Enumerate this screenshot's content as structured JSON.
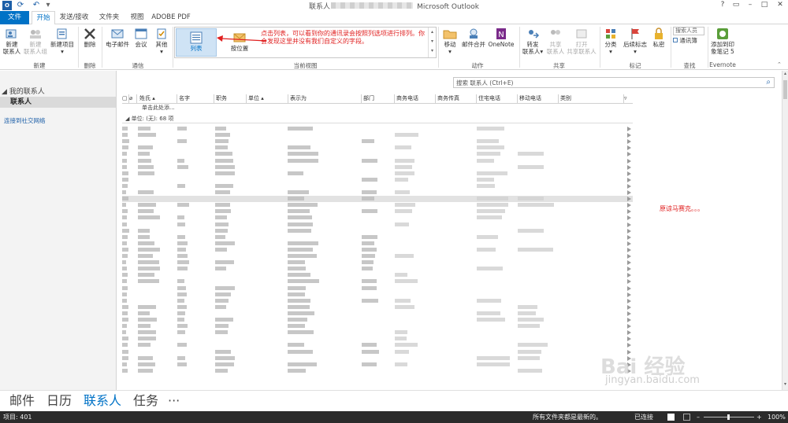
{
  "title_bar": {
    "title_left": "联系人",
    "title_right": "Microsoft Outlook",
    "quick_access": [
      "outlook-logo-icon",
      "send-receive-icon",
      "undo-icon",
      "customize-qat-icon"
    ],
    "window_controls": [
      "?",
      "restore",
      "–",
      "□",
      "✕"
    ]
  },
  "ribbon_tabs": [
    "文件",
    "开始",
    "发送/接收",
    "文件夹",
    "视图",
    "ADOBE PDF"
  ],
  "ribbon": {
    "new_group": {
      "label": "新建",
      "buttons": [
        {
          "label1": "新建",
          "label2": "联系人",
          "icon": "new-contact-icon"
        },
        {
          "label1": "新建",
          "label2": "联系人组",
          "icon": "new-contact-group-icon"
        },
        {
          "label1": "新建项目",
          "label2": "▾",
          "icon": "new-items-icon"
        }
      ]
    },
    "delete_group": {
      "label": "删除",
      "button": "删除"
    },
    "communicate_group": {
      "label": "通信",
      "buttons": [
        "电子邮件",
        "会议",
        "其他"
      ]
    },
    "current_view": {
      "label": "当前视图",
      "items": [
        "列表",
        "按位置"
      ],
      "annotation": "点击列表，可以看到你的通讯录会按照列选项进行排列。你会发现这里并没有我们自定义的字段。"
    },
    "actions_group": {
      "label": "动作",
      "buttons": [
        "移动",
        "邮件合并",
        "OneNote"
      ]
    },
    "share_group": {
      "label": "共享",
      "buttons": [
        {
          "label1": "转发",
          "label2": "联系人▾"
        },
        {
          "label1": "共享",
          "label2": "联系人"
        },
        {
          "label1": "打开",
          "label2": "共享联系人"
        }
      ]
    },
    "tags_group": {
      "label": "标记",
      "buttons": [
        "分类",
        "后续标志",
        "私密"
      ]
    },
    "find_group": {
      "label": "查找",
      "search_people": "搜索人员",
      "address_book": "通讯簿"
    },
    "evernote_group": {
      "label": "Evernote",
      "button1": "添加到印",
      "button2": "象笔记 5"
    }
  },
  "left_pane": {
    "header": "我的联系人",
    "selected_item": "联系人",
    "link": "连接到社交网络"
  },
  "content": {
    "search_placeholder": "搜索 联系人 (Ctrl+E)",
    "columns": [
      "姓氏",
      "名字",
      "职务",
      "单位",
      "表示为",
      "部门",
      "商务电话",
      "商务传真",
      "住宅电话",
      "移动电话",
      "类别"
    ],
    "add_new": "单击此处添...",
    "group_header": "单位: (无): 68 项",
    "side_note": "原谅马赛克。。。"
  },
  "nav_bar": [
    "邮件",
    "日历",
    "联系人",
    "任务",
    "···"
  ],
  "status_bar": {
    "items": "项目: 401",
    "sync": "所有文件夹都是最新的。",
    "connected": "已连接",
    "zoom": "100%"
  },
  "watermark": {
    "brand": "Bai 经验",
    "url": "jingyan.baidu.com"
  },
  "colors": {
    "accent": "#0072c6",
    "annotation": "#e02020",
    "status_bar": "#2b2b2b"
  }
}
